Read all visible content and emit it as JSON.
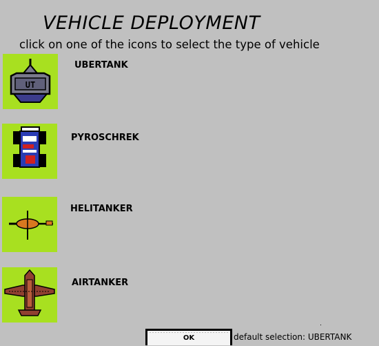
{
  "title": "VEHICLE DEPLOYMENT",
  "subtitle": "click on one of the icons to select the type of vehicle",
  "vehicles": [
    {
      "label": "UBERTANK",
      "icon": "ubertank-icon",
      "icon_text": "UT"
    },
    {
      "label": "PYROSCHREK",
      "icon": "pyroschrek-icon"
    },
    {
      "label": "HELITANKER",
      "icon": "helitanker-icon"
    },
    {
      "label": "AIRTANKER",
      "icon": "airtanker-icon"
    }
  ],
  "ok_label": "OK",
  "default_selection": "default selection: UBERTANK",
  "colors": {
    "background": "#c0c0c0",
    "icon_background": "#a8e020"
  }
}
